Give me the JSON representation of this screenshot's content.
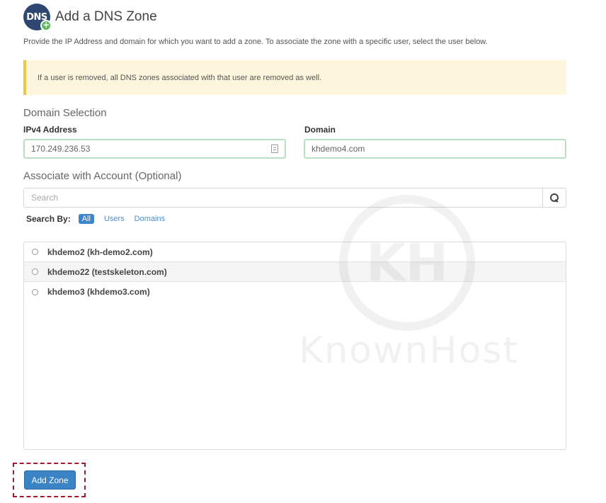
{
  "header": {
    "icon_text": "DNS",
    "title": "Add a DNS Zone"
  },
  "description": "Provide the IP Address and domain for which you want to add a zone. To associate the zone with a specific user, select the user below.",
  "warning": "If a user is removed, all DNS zones associated with that user are removed as well.",
  "domain_selection": {
    "heading": "Domain Selection",
    "ip_label": "IPv4 Address",
    "ip_value": "170.249.236.53",
    "domain_label": "Domain",
    "domain_value": "khdemo4.com"
  },
  "account": {
    "heading": "Associate with Account (Optional)",
    "search_placeholder": "Search",
    "search_by_label": "Search By:",
    "filters": [
      {
        "label": "All",
        "active": true
      },
      {
        "label": "Users",
        "active": false
      },
      {
        "label": "Domains",
        "active": false
      }
    ],
    "items": [
      {
        "label": "khdemo2 (kh-demo2.com)"
      },
      {
        "label": "khdemo22 (testskeleton.com)"
      },
      {
        "label": "khdemo3 (khdemo3.com)"
      }
    ]
  },
  "watermark": {
    "logo_text": "KH",
    "brand_text": "KnownHost"
  },
  "submit_label": "Add Zone",
  "colors": {
    "primary": "#3a83c4",
    "warning_border": "#f0c548",
    "highlight": "#a31a2e"
  }
}
